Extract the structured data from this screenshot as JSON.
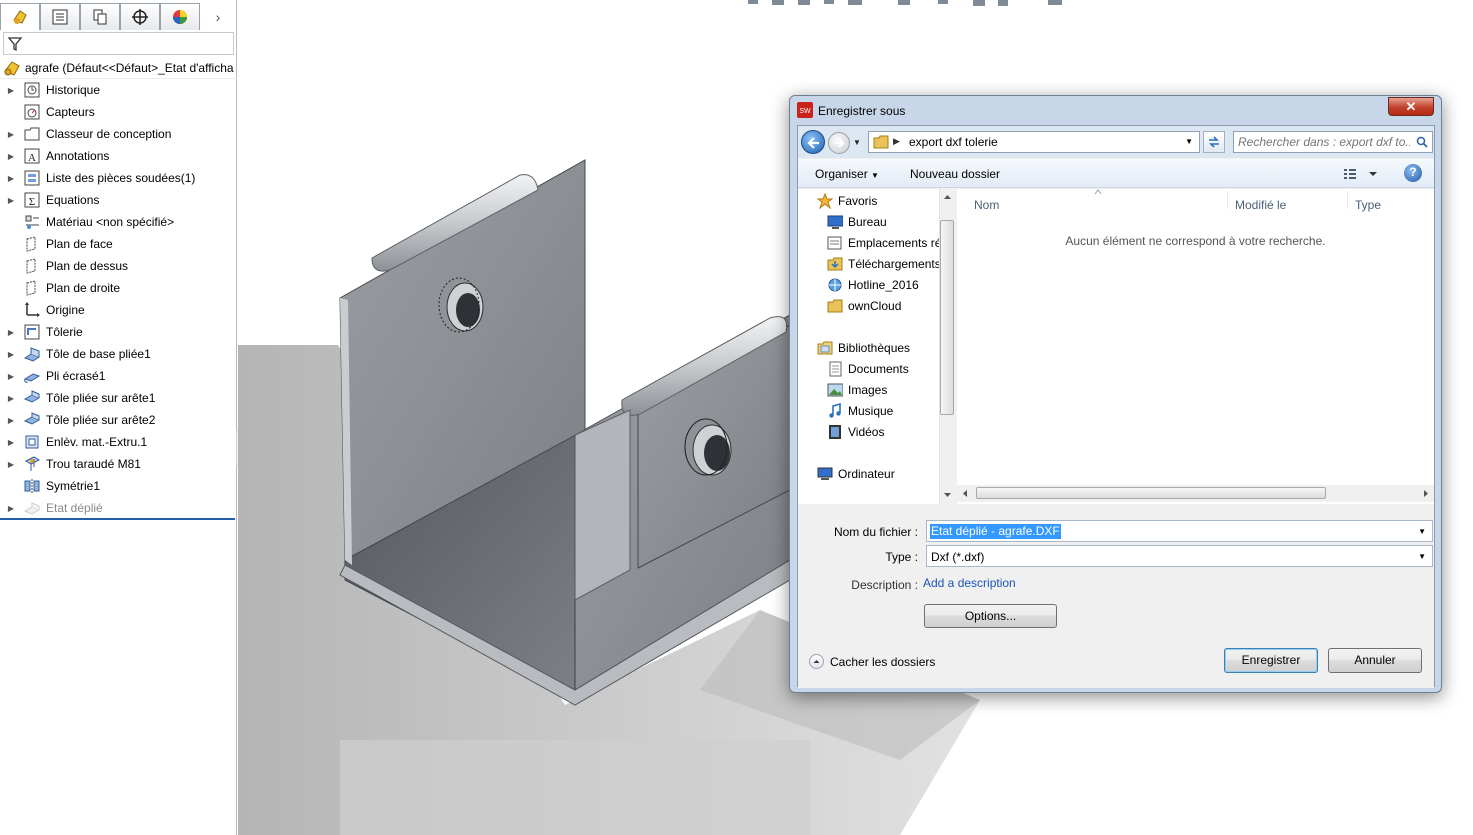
{
  "feature_tree": {
    "root_label": "agrafe  (Défaut<<Défaut>_Etat d'afficha",
    "items": [
      {
        "label": "Historique",
        "icon": "history-icon",
        "expand": true,
        "dim": false
      },
      {
        "label": "Capteurs",
        "icon": "sensor-icon",
        "expand": false,
        "dim": false
      },
      {
        "label": "Classeur de conception",
        "icon": "design-binder-icon",
        "expand": true,
        "dim": false
      },
      {
        "label": "Annotations",
        "icon": "annotation-icon",
        "expand": true,
        "dim": false
      },
      {
        "label": "Liste des pièces soudées(1)",
        "icon": "cut-list-icon",
        "expand": true,
        "dim": false
      },
      {
        "label": "Equations",
        "icon": "equation-icon",
        "expand": true,
        "dim": false
      },
      {
        "label": "Matériau <non spécifié>",
        "icon": "material-icon",
        "expand": false,
        "dim": false
      },
      {
        "label": "Plan de face",
        "icon": "plane-icon",
        "expand": false,
        "dim": false
      },
      {
        "label": "Plan de dessus",
        "icon": "plane-icon",
        "expand": false,
        "dim": false
      },
      {
        "label": "Plan de droite",
        "icon": "plane-icon",
        "expand": false,
        "dim": false
      },
      {
        "label": "Origine",
        "icon": "origin-icon",
        "expand": false,
        "dim": false
      },
      {
        "label": "Tôlerie",
        "icon": "sheet-metal-icon",
        "expand": true,
        "dim": false
      },
      {
        "label": "Tôle de base pliée1",
        "icon": "base-flange-icon",
        "expand": true,
        "dim": false
      },
      {
        "label": "Pli écrasé1",
        "icon": "hem-icon",
        "expand": true,
        "dim": false
      },
      {
        "label": "Tôle pliée sur arête1",
        "icon": "edge-flange-icon",
        "expand": true,
        "dim": false
      },
      {
        "label": "Tôle pliée sur arête2",
        "icon": "edge-flange-icon",
        "expand": true,
        "dim": false
      },
      {
        "label": "Enlèv. mat.-Extru.1",
        "icon": "extruded-cut-icon",
        "expand": true,
        "dim": false
      },
      {
        "label": "Trou taraudé M81",
        "icon": "hole-wizard-icon",
        "expand": true,
        "dim": false
      },
      {
        "label": "Symétrie1",
        "icon": "mirror-icon",
        "expand": false,
        "dim": false
      },
      {
        "label": "Etat déplié",
        "icon": "flat-pattern-icon",
        "expand": true,
        "dim": true
      }
    ]
  },
  "dialog": {
    "title": "Enregistrer sous",
    "close_glyph": "✕",
    "address_path": "export dxf tolerie",
    "search_placeholder": "Rechercher dans : export dxf to...",
    "organise_label": "Organiser",
    "new_folder_label": "Nouveau dossier",
    "help_glyph": "?",
    "nav_groups": [
      {
        "label": "Favoris",
        "icon": "star-icon",
        "indent": false
      },
      {
        "label": "Bureau",
        "icon": "desktop-icon",
        "indent": true
      },
      {
        "label": "Emplacements ré",
        "icon": "recent-places-icon",
        "indent": true
      },
      {
        "label": "Téléchargements",
        "icon": "downloads-folder-icon",
        "indent": true
      },
      {
        "label": "Hotline_2016",
        "icon": "network-folder-icon",
        "indent": true
      },
      {
        "label": "ownCloud",
        "icon": "folder-icon",
        "indent": true
      },
      {
        "label": "Bibliothèques",
        "icon": "libraries-icon",
        "indent": false
      },
      {
        "label": "Documents",
        "icon": "documents-icon",
        "indent": true
      },
      {
        "label": "Images",
        "icon": "pictures-icon",
        "indent": true
      },
      {
        "label": "Musique",
        "icon": "music-icon",
        "indent": true
      },
      {
        "label": "Vidéos",
        "icon": "videos-icon",
        "indent": true
      },
      {
        "label": "Ordinateur",
        "icon": "computer-icon",
        "indent": false
      }
    ],
    "columns": {
      "name": "Nom",
      "modified": "Modifié le",
      "type": "Type"
    },
    "empty_message": "Aucun élément ne correspond à votre recherche.",
    "filename_label": "Nom du fichier :",
    "filename_value": "Etat déplié - agrafe.DXF",
    "type_label": "Type :",
    "type_value": "Dxf (*.dxf)",
    "description_label": "Description :",
    "description_link": "Add a description",
    "options_label": "Options...",
    "hide_folders_label": "Cacher les dossiers",
    "save_label": "Enregistrer",
    "cancel_label": "Annuler"
  },
  "colors": {
    "accent": "#3399ff",
    "link": "#1c53b7",
    "close": "#c3402c"
  }
}
